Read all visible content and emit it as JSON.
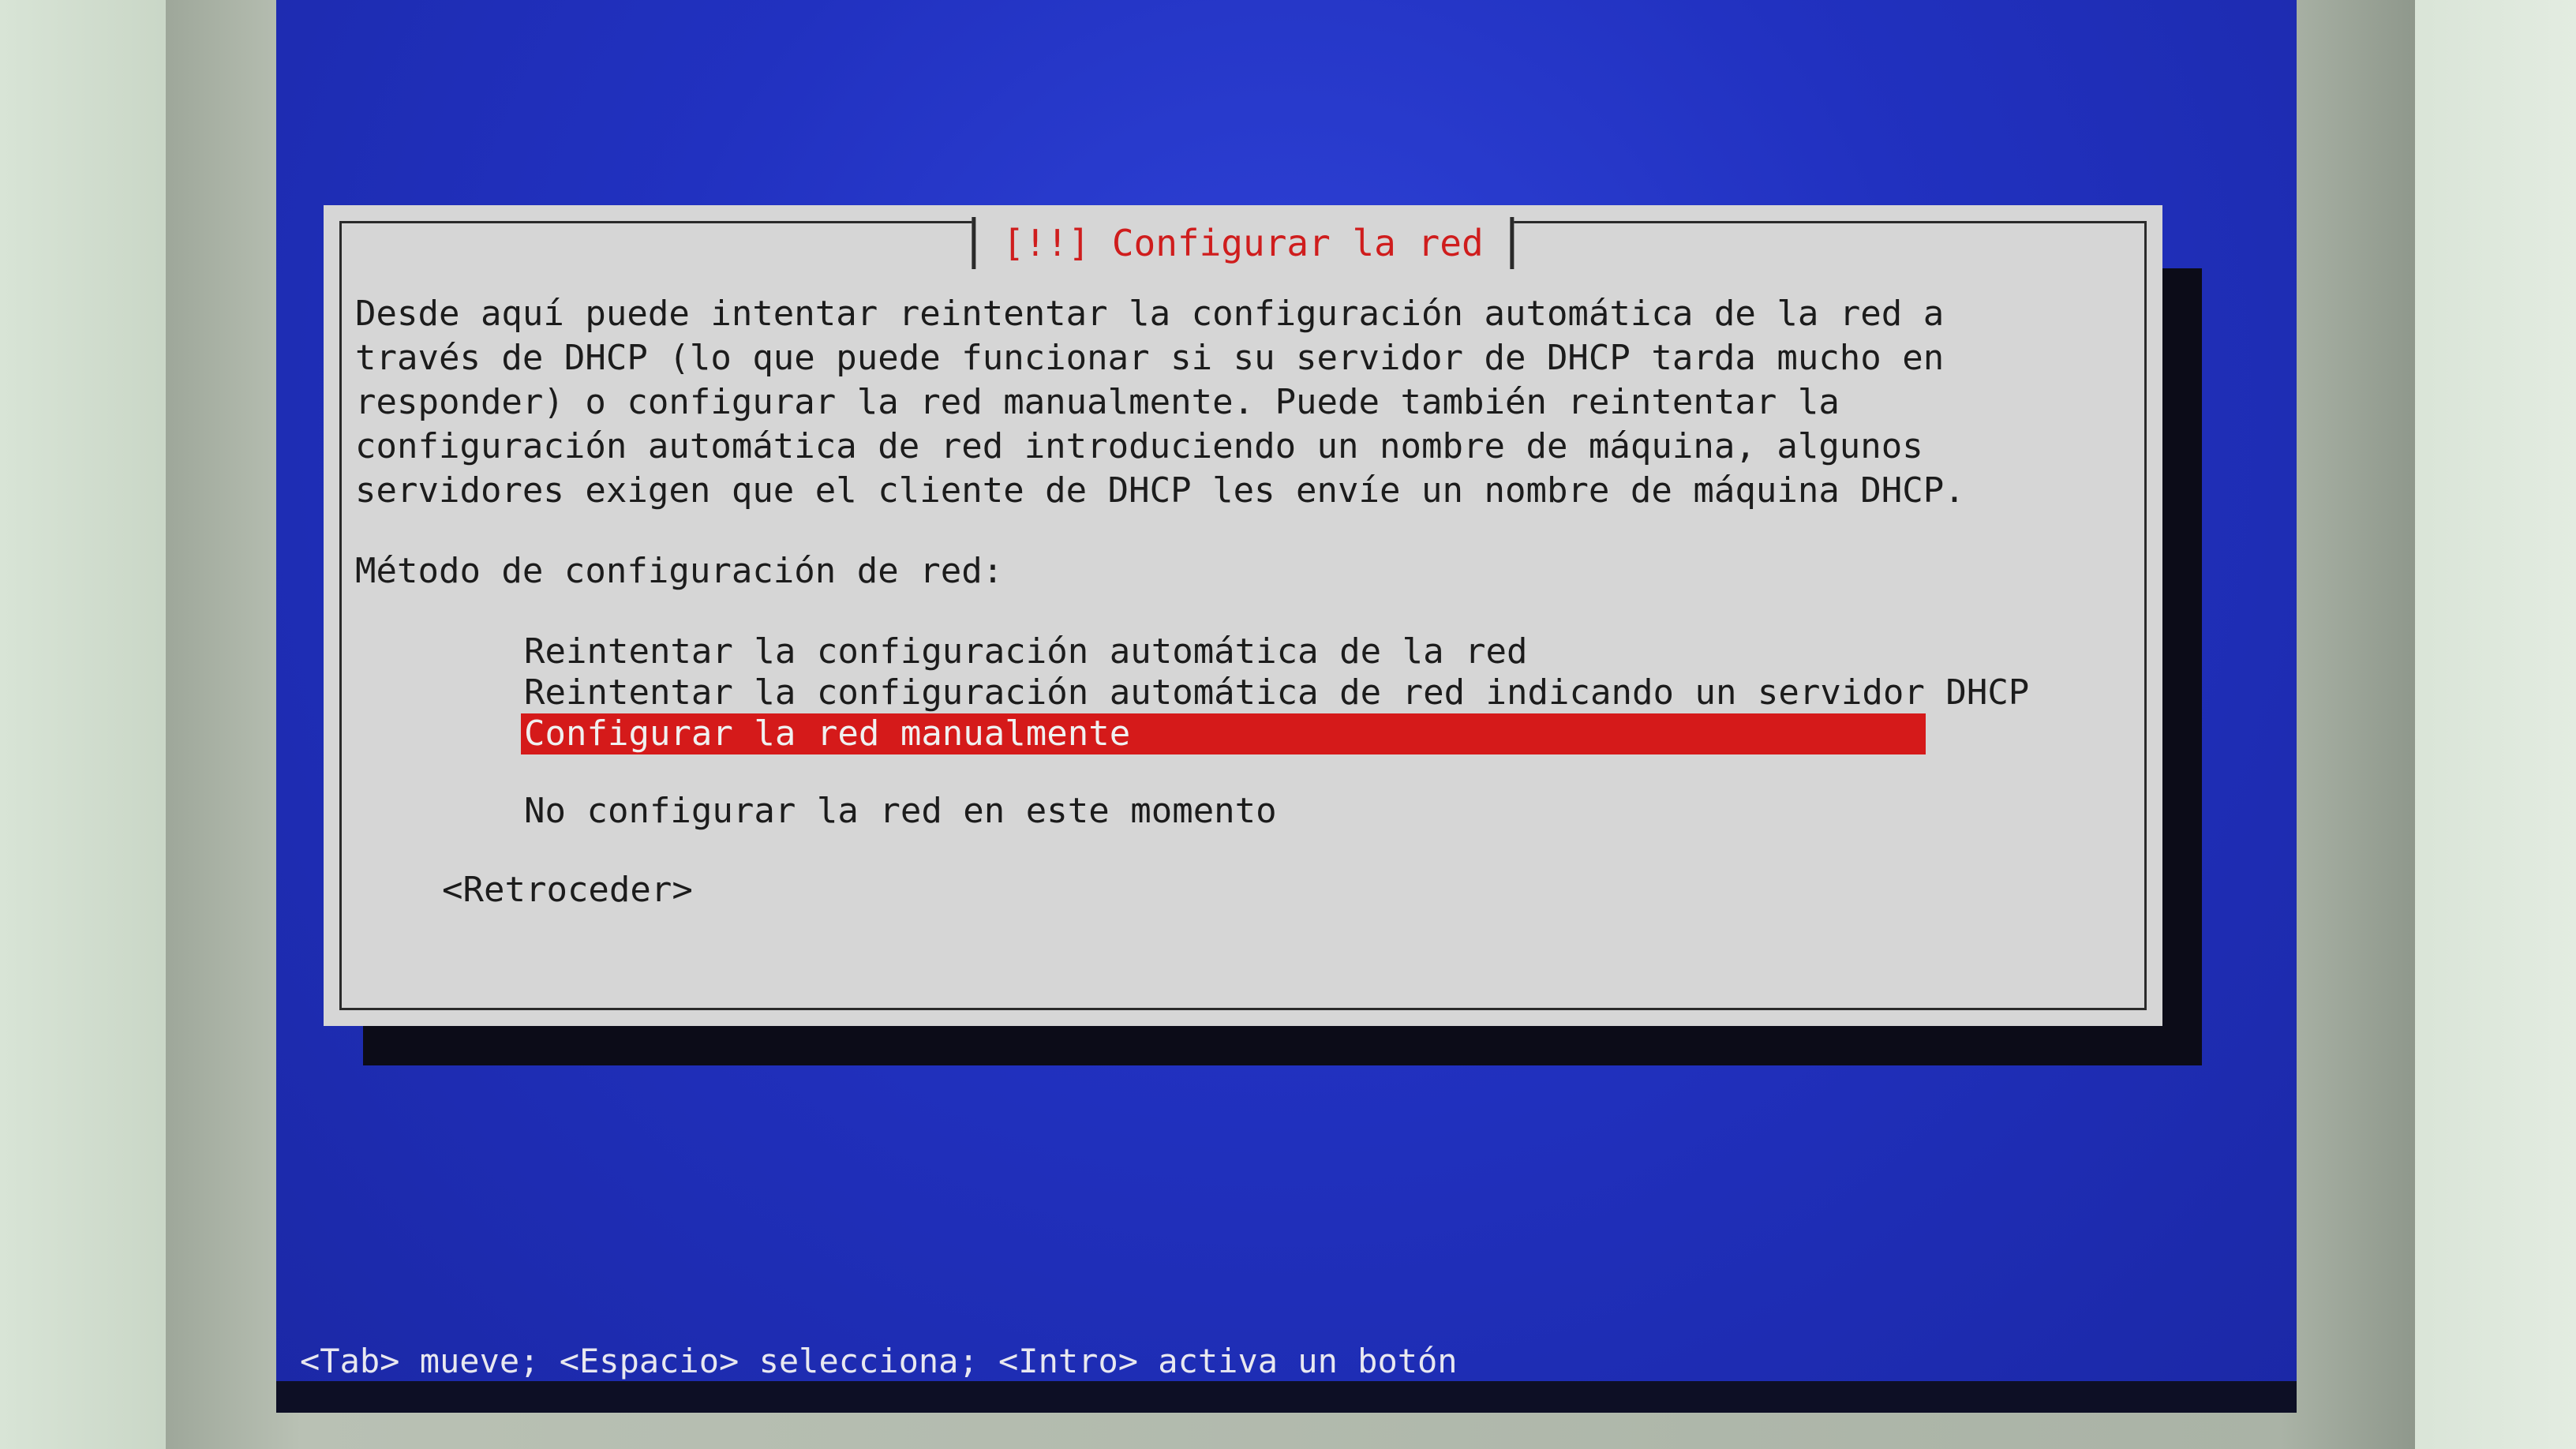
{
  "dialog": {
    "title": "[!!] Configurar la red",
    "description": "Desde aquí puede intentar reintentar la configuración automática de la red a través de DHCP (lo que puede funcionar si su servidor de DHCP tarda mucho en responder) o configurar la red manualmente. Puede también reintentar la configuración automática de red introduciendo un nombre de máquina, algunos servidores exigen que el cliente de DHCP les envíe un nombre de máquina DHCP.",
    "method_label": "Método de configuración de red:",
    "options": [
      "Reintentar la configuración automática de la red",
      "Reintentar la configuración automática de red indicando un servidor DHCP",
      "Configurar la red manualmente",
      "No configurar la red en este momento"
    ],
    "selected_option": "Configurar la red manualmente",
    "back_button": "<Retroceder>"
  },
  "help_line": "<Tab> mueve; <Espacio> selecciona; <Intro> activa un botón",
  "colors": {
    "screen_background": "#2131c0",
    "dialog_background": "#d6d6d6",
    "title_text": "#cf1d1d",
    "selection_highlight": "#d51a1a"
  }
}
